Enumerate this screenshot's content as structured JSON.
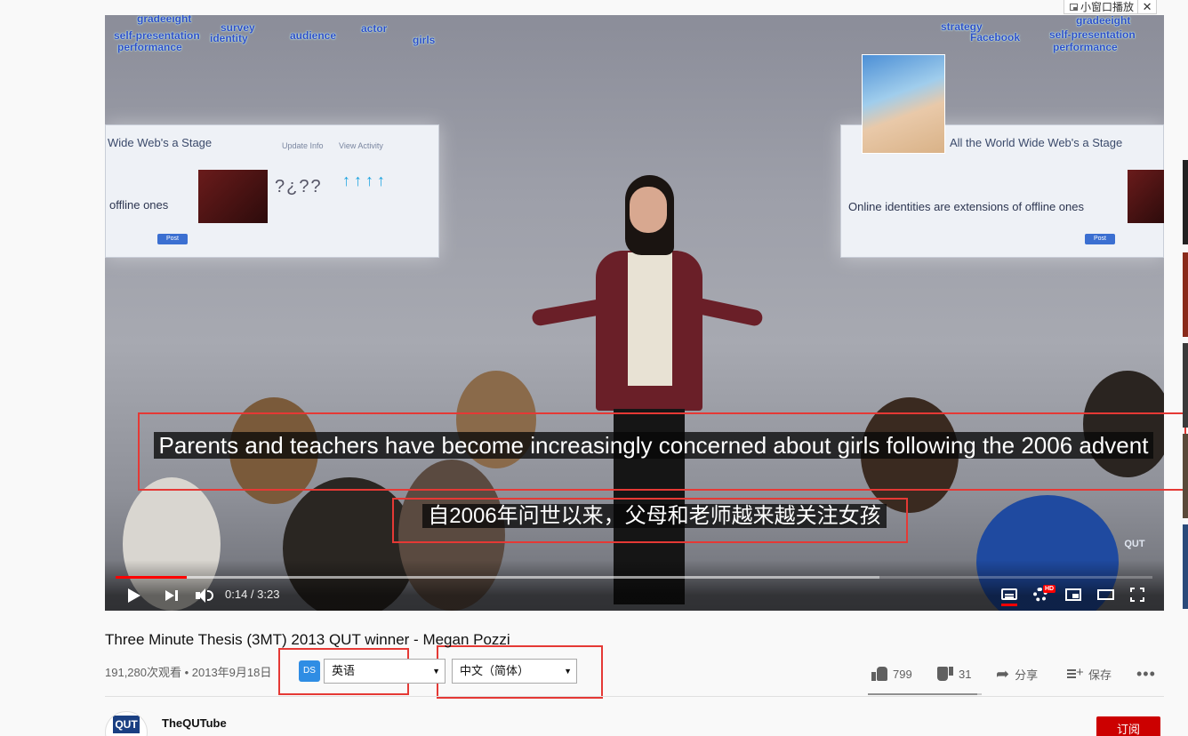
{
  "miniplayer": {
    "label": "小窗口播放",
    "close": "✕"
  },
  "video": {
    "wall_text": [
      "gradeeight",
      "self-presentation",
      "performance",
      "survey",
      "identity",
      "audience",
      "actor",
      "girls",
      "strategy",
      "Facebook",
      "gradeeight",
      "self-presentation",
      "performance"
    ],
    "screen_left": {
      "title": "Wide Web's a Stage",
      "update_info": "Update Info",
      "view_activity": "View Activity",
      "subtitle": "offline ones",
      "post": "Post"
    },
    "screen_right": {
      "title": "All the World Wide Web's a Stage",
      "subtitle": "Online identities are extensions of offline ones",
      "post": "Post"
    },
    "watermark": "QUT"
  },
  "subtitles": {
    "english": "Parents and teachers have become increasingly concerned about girls following the 2006 advent",
    "chinese": "自2006年问世以来，父母和老师越来越关注女孩"
  },
  "player": {
    "current_time": "0:14",
    "duration": "3:23",
    "time_display": "0:14 / 3:23",
    "played_fraction": 0.069,
    "buffered_fraction": 0.737,
    "hd_badge": "HD",
    "icons": [
      "play-icon",
      "next-icon",
      "volume-icon",
      "subtitles-icon",
      "settings-icon",
      "miniplayer-icon",
      "theater-icon",
      "fullscreen-icon"
    ]
  },
  "info": {
    "title": "Three Minute Thesis (3MT) 2013 QUT winner - Megan Pozzi",
    "views_date": "191,280次观看 • 2013年9月18日",
    "plugin_badge": "DS",
    "source_lang": "英语",
    "target_lang": "中文（简体）",
    "likes": "799",
    "dislikes": "31",
    "share": "分享",
    "save": "保存",
    "more": "•••",
    "like_ratio": 0.963
  },
  "channel": {
    "avatar_text": "QUT",
    "name": "TheQUTube",
    "subscribe": "订阅"
  },
  "colors": {
    "accent_red": "#ff0000",
    "annotation_red": "#e53935",
    "plugin_blue": "#2f8de4",
    "subscribe_red": "#cc0000"
  }
}
